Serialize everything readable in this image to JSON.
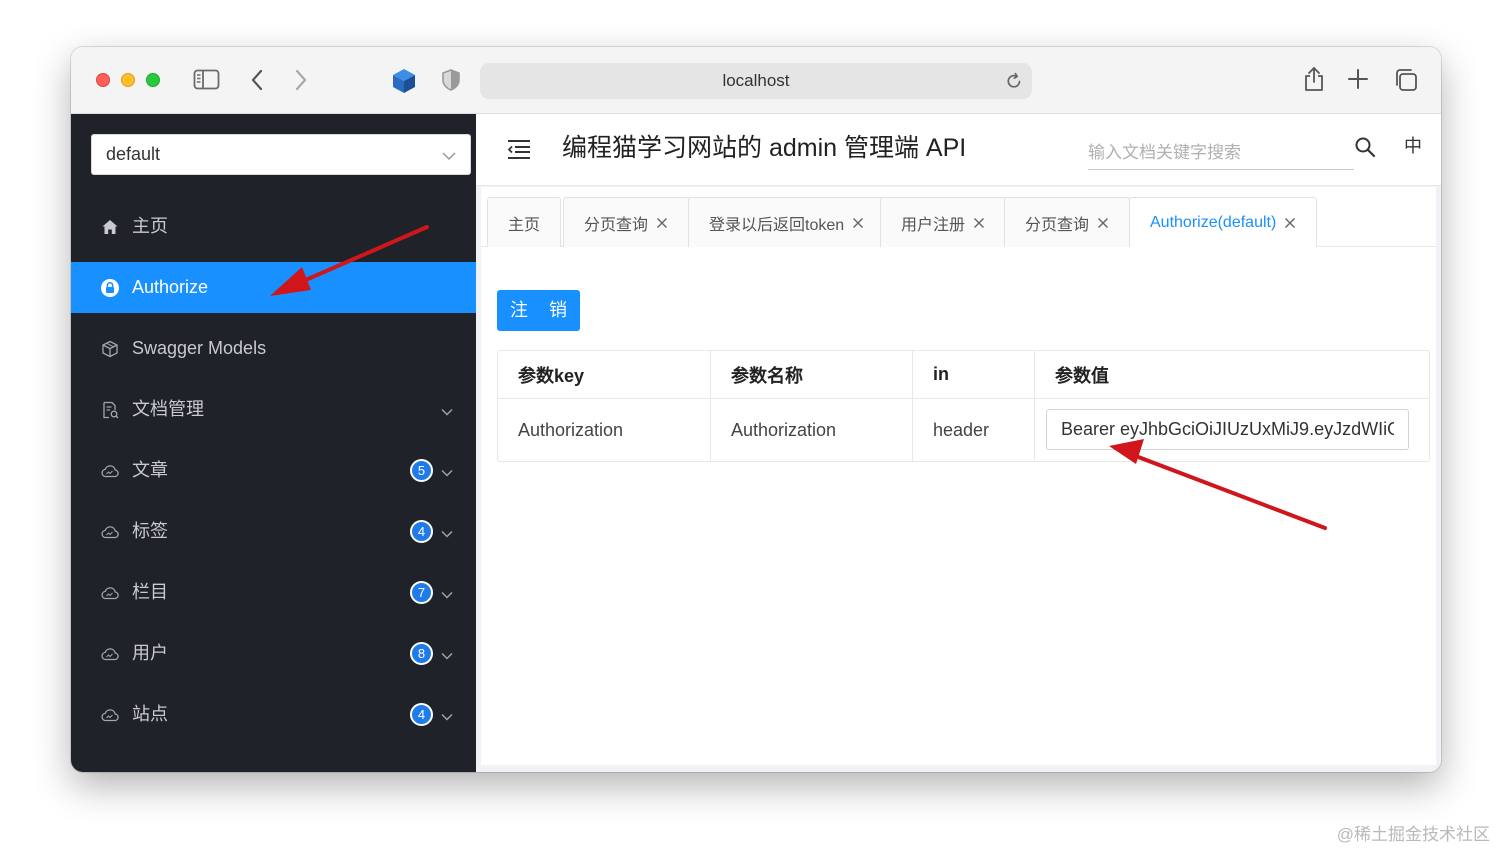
{
  "browser": {
    "url": "localhost"
  },
  "sidebar": {
    "group_select": "default",
    "items": [
      {
        "label": "主页",
        "icon": "home-icon",
        "active": false
      },
      {
        "label": "Authorize",
        "icon": "lock-icon",
        "active": true
      },
      {
        "label": "Swagger Models",
        "icon": "cube-icon",
        "active": false
      },
      {
        "label": "文档管理",
        "icon": "document-icon",
        "active": false
      },
      {
        "label": "文章",
        "icon": "cloud-icon",
        "badge": "5"
      },
      {
        "label": "标签",
        "icon": "cloud-icon",
        "badge": "4"
      },
      {
        "label": "栏目",
        "icon": "cloud-icon",
        "badge": "7"
      },
      {
        "label": "用户",
        "icon": "cloud-icon",
        "badge": "8"
      },
      {
        "label": "站点",
        "icon": "cloud-icon",
        "badge": "4"
      }
    ]
  },
  "header": {
    "title": "编程猫学习网站的 admin 管理端 API",
    "search_placeholder": "输入文档关键字搜索",
    "lang": "中"
  },
  "tabs": [
    {
      "label": "主页",
      "closable": false
    },
    {
      "label": "分页查询",
      "closable": true
    },
    {
      "label": "登录以后返回token",
      "closable": true
    },
    {
      "label": "用户注册",
      "closable": true
    },
    {
      "label": "分页查询",
      "closable": true
    },
    {
      "label": "Authorize(default)",
      "closable": true,
      "active": true
    }
  ],
  "content": {
    "logout_label": "注 销",
    "table": {
      "headers": [
        "参数key",
        "参数名称",
        "in",
        "参数值"
      ],
      "rows": [
        {
          "key": "Authorization",
          "name": "Authorization",
          "in": "header",
          "value": "Bearer eyJhbGciOiJIUzUxMiJ9.eyJzdWIiO"
        }
      ]
    }
  },
  "watermark": "@稀土掘金技术社区",
  "colors": {
    "sidebar_bg": "#1f2329",
    "accent": "#1890ff",
    "annotation_arrow": "#d0161b"
  }
}
